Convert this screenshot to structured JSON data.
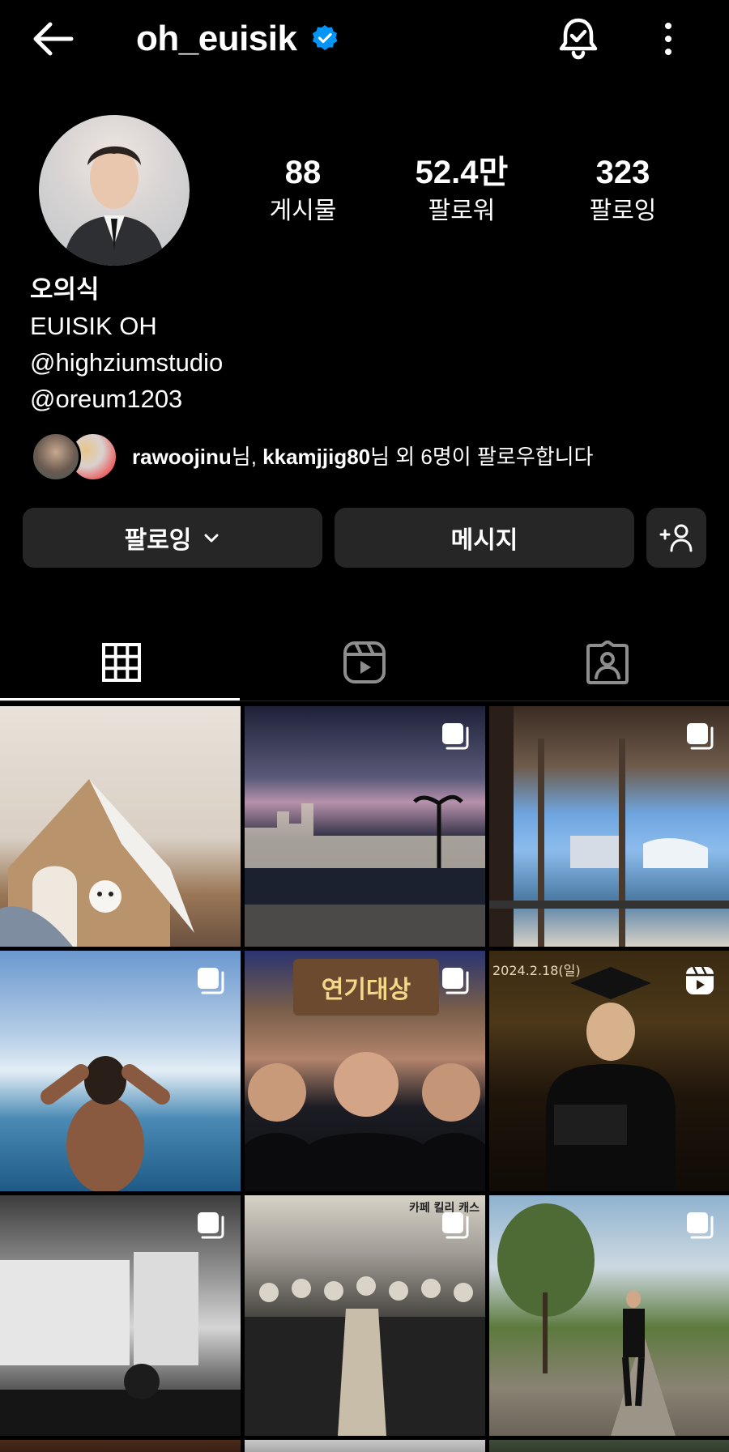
{
  "header": {
    "username": "oh_euisik",
    "verified": true,
    "icons": [
      "back-arrow-icon",
      "verified-badge-icon",
      "notification-bell-icon",
      "more-options-icon"
    ]
  },
  "profile": {
    "stats": {
      "posts_count": "88",
      "posts_label": "게시물",
      "followers_count": "52.4만",
      "followers_label": "팔로워",
      "following_count": "323",
      "following_label": "팔로잉"
    },
    "bio": {
      "name": "오의식",
      "line1": "EUISIK OH",
      "line2": "@highziumstudio",
      "line3": "@oreum1203"
    },
    "mutual": {
      "user1": "rawoojinu",
      "sep1": "님, ",
      "user2": "kkamjjig80",
      "rest": "님 외 6명이 팔로우합니다"
    }
  },
  "actions": {
    "following_label": "팔로잉",
    "message_label": "메시지"
  },
  "tabs": [
    "grid",
    "reels",
    "tagged"
  ],
  "colors": {
    "background": "#000000",
    "button_bg": "#262626",
    "verified_blue": "#0095F6",
    "text": "#FFFFFF"
  },
  "grid": {
    "posts": [
      {
        "badge": "none"
      },
      {
        "badge": "carousel"
      },
      {
        "badge": "carousel"
      },
      {
        "badge": "carousel"
      },
      {
        "badge": "carousel",
        "overlay_text": "연기대상"
      },
      {
        "badge": "reel",
        "overlay_text": "2024.2.18(일)"
      },
      {
        "badge": "carousel"
      },
      {
        "badge": "carousel",
        "overlay_text": "카페 킬리 캐스"
      },
      {
        "badge": "carousel"
      }
    ]
  }
}
